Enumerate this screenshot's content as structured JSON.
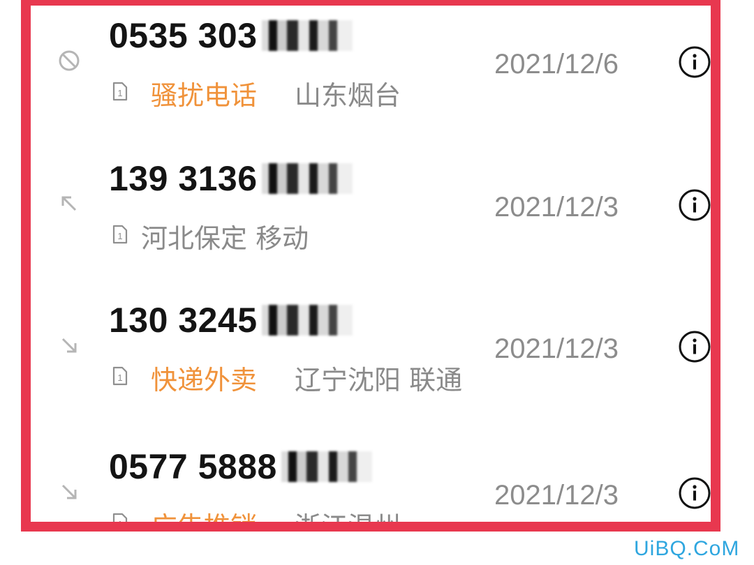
{
  "calls": [
    {
      "type_icon": "blocked-icon",
      "number": "0535 303",
      "tag": "骚扰电话",
      "location": "山东烟台",
      "date": "2021/12/6"
    },
    {
      "type_icon": "outgoing-call-icon",
      "number": "139 3136",
      "tag": "",
      "location": "河北保定 移动",
      "date": "2021/12/3"
    },
    {
      "type_icon": "incoming-call-icon",
      "number": "130 3245",
      "tag": "快递外卖",
      "location": "辽宁沈阳 联通",
      "date": "2021/12/3"
    },
    {
      "type_icon": "incoming-call-icon",
      "number": "0577 5888",
      "tag": "广告推销",
      "location": "浙江温州",
      "date": "2021/12/3"
    }
  ],
  "sim_label": "1",
  "colors": {
    "frame": "#e8384f",
    "tag": "#f0923a",
    "watermark": "#2ea6df"
  },
  "watermark": "UiBQ.CoM"
}
